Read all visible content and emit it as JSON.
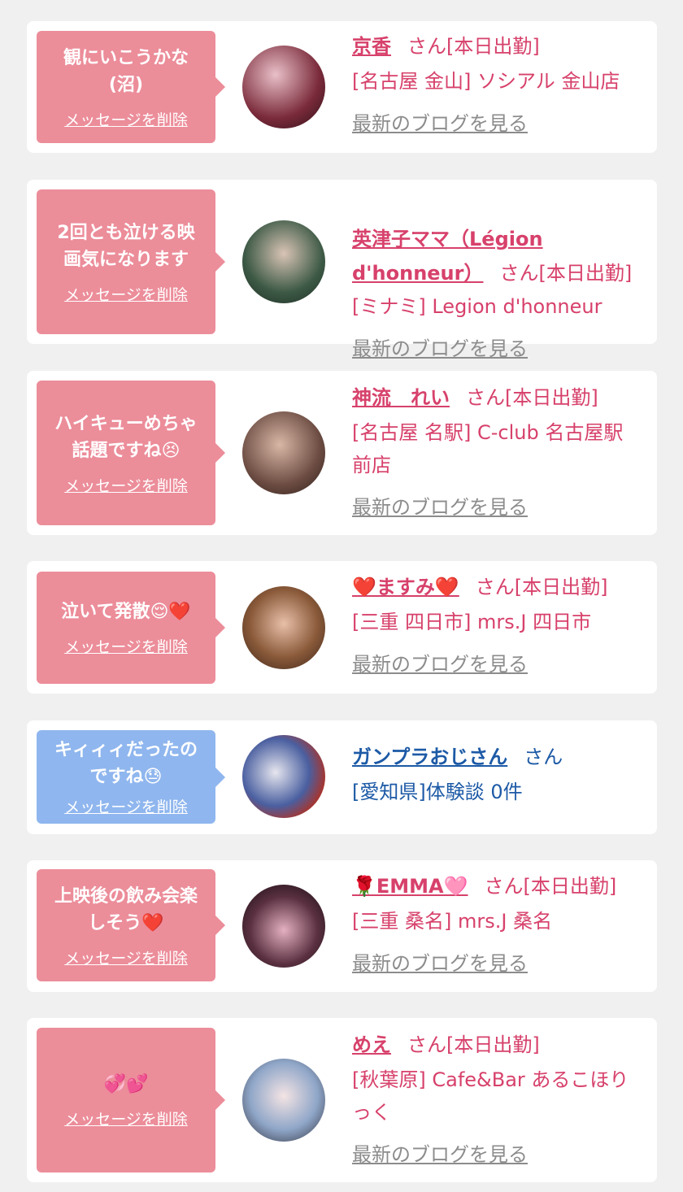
{
  "delete_label": "メッセージを削除",
  "blog_label": "最新のブログを見る",
  "colors": {
    "pink_bubble": "#ec8d9a",
    "blue_bubble": "#8fb6ee",
    "pink_text": "#d7416b",
    "blue_text": "#1d5aa6"
  },
  "cards": [
    {
      "message": "観にいこうかな\n(沼)",
      "name": "京香",
      "suffix": "さん[本日出勤]",
      "shop": "[名古屋 金山] ソシアル 金山店",
      "avatar_icon": "avatar-photo"
    },
    {
      "message": "2回とも泣ける映\n画気になります",
      "name": "英津子ママ（Légion\nd'honneur）",
      "suffix": "さん[本日出勤]",
      "shop": "[ミナミ] Legion d'honneur",
      "avatar_icon": "avatar-photo"
    },
    {
      "message": "ハイキューめちゃ\n話題ですね😣",
      "name": "神流　れい",
      "suffix": "さん[本日出勤]",
      "shop": "[名古屋 名駅] C-club 名古屋駅\n前店",
      "avatar_icon": "avatar-photo"
    },
    {
      "message": "泣いて発散😌❤️",
      "name": "❤️ますみ❤️",
      "suffix": "さん[本日出勤]",
      "shop": "[三重 四日市] mrs.J 四日市",
      "avatar_icon": "avatar-photo"
    },
    {
      "message": "キィィィだったの\nですね😓",
      "name": "ガンプラおじさん",
      "suffix": "さん",
      "shop": "[愛知県]体験談 0件",
      "avatar_icon": "avatar-photo"
    },
    {
      "message": "上映後の飲み会楽\nしそう❤️",
      "name": "🌹EMMA🩷",
      "suffix": "さん[本日出勤]",
      "shop": "[三重 桑名] mrs.J 桑名",
      "avatar_icon": "avatar-photo"
    },
    {
      "message": "💞💕",
      "name": "めえ",
      "suffix": "さん[本日出勤]",
      "shop": "[秋葉原] Cafe&Bar あるこほり\nっく",
      "avatar_icon": "avatar-photo"
    }
  ]
}
